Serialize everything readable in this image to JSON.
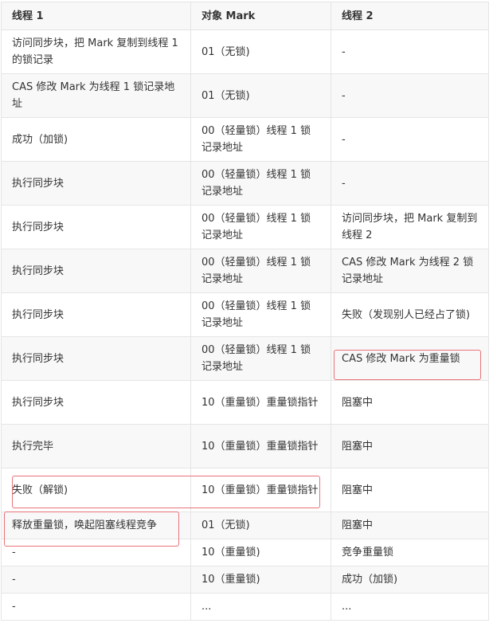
{
  "table": {
    "headers": [
      "线程 1",
      "对象 Mark",
      "线程 2"
    ],
    "rows": [
      [
        "访问同步块，把 Mark 复制到线程 1 的锁记录",
        "01（无锁)",
        "-"
      ],
      [
        "CAS 修改 Mark 为线程 1 锁记录地址",
        "01（无锁)",
        "-"
      ],
      [
        "成功（加锁)",
        "00（轻量锁）线程 1 锁记录地址",
        "-"
      ],
      [
        "执行同步块",
        "00（轻量锁）线程 1 锁记录地址",
        "-"
      ],
      [
        "执行同步块",
        "00（轻量锁）线程 1 锁记录地址",
        "访问同步块，把 Mark 复制到线程 2"
      ],
      [
        "执行同步块",
        "00（轻量锁）线程 1 锁记录地址",
        "CAS 修改 Mark 为线程 2 锁记录地址"
      ],
      [
        "执行同步块",
        "00（轻量锁）线程 1 锁记录地址",
        "失败（发现别人已经占了锁)"
      ],
      [
        "执行同步块",
        "00（轻量锁）线程 1 锁记录地址",
        "CAS 修改 Mark 为重量锁"
      ],
      [
        "执行同步块",
        "10（重量锁）重量锁指针",
        "阻塞中"
      ],
      [
        "执行完毕",
        "10（重量锁）重量锁指针",
        "阻塞中"
      ],
      [
        "失败（解锁)",
        "10（重量锁）重量锁指针",
        "阻塞中"
      ],
      [
        "释放重量锁，唤起阻塞线程竞争",
        "01（无锁)",
        "阻塞中"
      ],
      [
        "-",
        "10（重量锁)",
        "竞争重量锁"
      ],
      [
        "-",
        "10（重量锁)",
        "成功（加锁)"
      ],
      [
        "-",
        "...",
        "..."
      ]
    ]
  },
  "highlight_color": "#e8737a"
}
